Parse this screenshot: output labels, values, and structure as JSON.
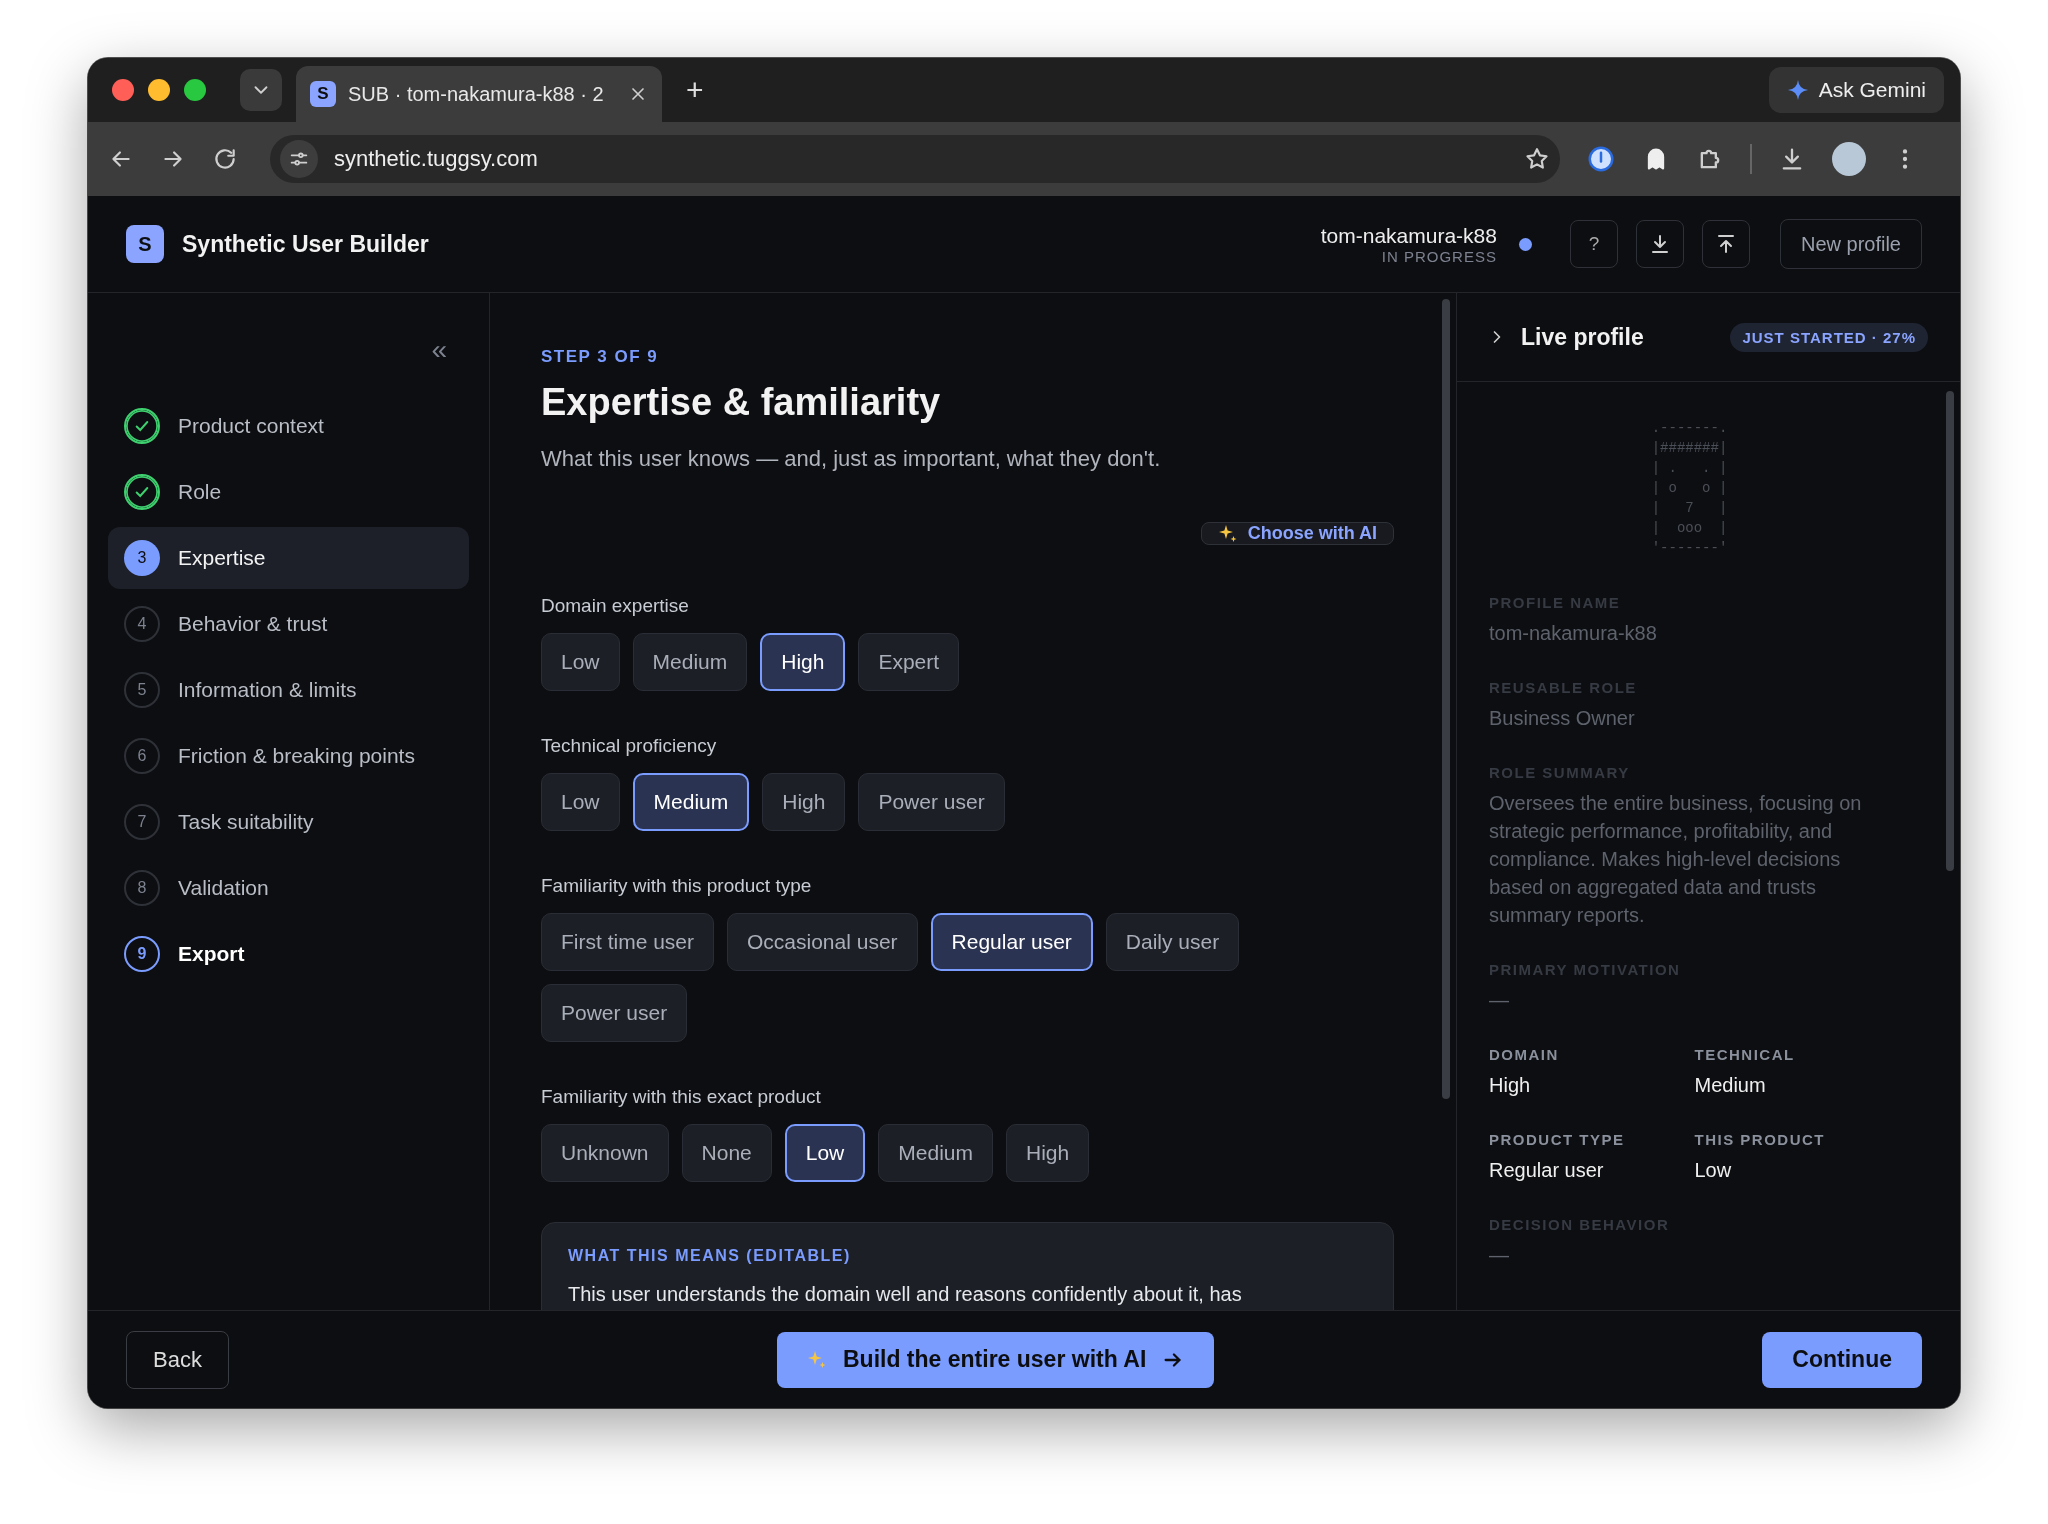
{
  "browser": {
    "tab": {
      "favicon": "S",
      "title": "SUB · tom-nakamura-k88 · 2"
    },
    "new_tab": "+",
    "ask_gemini": "Ask Gemini",
    "url": "synthetic.tuggsy.com"
  },
  "app": {
    "logo": "S",
    "title": "Synthetic User Builder",
    "profile_name": "tom-nakamura-k88",
    "status": "IN PROGRESS",
    "help": "?",
    "new_profile": "New profile"
  },
  "sidebar": {
    "collapse": "«",
    "steps": [
      {
        "label": "Product context",
        "kind": "done",
        "selected": false
      },
      {
        "label": "Role",
        "kind": "done",
        "selected": false
      },
      {
        "number": "3",
        "label": "Expertise",
        "kind": "current",
        "selected": true
      },
      {
        "number": "4",
        "label": "Behavior & trust",
        "kind": "pending",
        "selected": false
      },
      {
        "number": "5",
        "label": "Information & limits",
        "kind": "pending",
        "selected": false
      },
      {
        "number": "6",
        "label": "Friction & breaking points",
        "kind": "pending",
        "selected": false
      },
      {
        "number": "7",
        "label": "Task suitability",
        "kind": "pending",
        "selected": false
      },
      {
        "number": "8",
        "label": "Validation",
        "kind": "pending",
        "selected": false
      },
      {
        "number": "9",
        "label": "Export",
        "kind": "target",
        "selected": false
      }
    ]
  },
  "main": {
    "step": "STEP 3 OF 9",
    "title": "Expertise & familiarity",
    "subtitle": "What this user knows — and, just as important, what they don't.",
    "ai_button": "Choose with AI",
    "groups": [
      {
        "label": "Domain expertise",
        "options": [
          {
            "label": "Low",
            "selected": false
          },
          {
            "label": "Medium",
            "selected": false
          },
          {
            "label": "High",
            "selected": true
          },
          {
            "label": "Expert",
            "selected": false
          }
        ]
      },
      {
        "label": "Technical proficiency",
        "options": [
          {
            "label": "Low",
            "selected": false
          },
          {
            "label": "Medium",
            "selected": true
          },
          {
            "label": "High",
            "selected": false
          },
          {
            "label": "Power user",
            "selected": false
          }
        ]
      },
      {
        "label": "Familiarity with this product type",
        "options": [
          {
            "label": "First time user",
            "selected": false
          },
          {
            "label": "Occasional user",
            "selected": false
          },
          {
            "label": "Regular user",
            "selected": true
          },
          {
            "label": "Daily user",
            "selected": false
          },
          {
            "label": "Power user",
            "selected": false
          }
        ]
      },
      {
        "label": "Familiarity with this exact product",
        "options": [
          {
            "label": "Unknown",
            "selected": false
          },
          {
            "label": "None",
            "selected": false
          },
          {
            "label": "Low",
            "selected": true
          },
          {
            "label": "Medium",
            "selected": false
          },
          {
            "label": "High",
            "selected": false
          }
        ]
      }
    ],
    "note": {
      "title": "WHAT THIS MEANS (EDITABLE)",
      "text": "This user understands the domain well and reasons confidently about it, has"
    }
  },
  "profile": {
    "title": "Live profile",
    "badge": "JUST STARTED · 27%",
    "avatar_lines": [
      ".-------.",
      "|#######|",
      "| .   . |",
      "| o   o |",
      "|   7   |",
      "|  ooo  |",
      "'-------'"
    ],
    "fields": [
      {
        "label": "PROFILE NAME",
        "value": "tom-nakamura-k88",
        "dimmed": true
      },
      {
        "label": "REUSABLE ROLE",
        "value": "Business Owner",
        "dimmed": true
      },
      {
        "label": "ROLE SUMMARY",
        "value": "Oversees the entire business, focusing on strategic performance, profitability, and compliance. Makes high-level decisions based on aggregated data and trusts summary reports.",
        "dimmed": true
      },
      {
        "label": "PRIMARY MOTIVATION",
        "value": "—",
        "dimmed": true
      }
    ],
    "grid": [
      {
        "label": "DOMAIN",
        "value": "High",
        "dimmed": false
      },
      {
        "label": "TECHNICAL",
        "value": "Medium",
        "dimmed": false
      },
      {
        "label": "PRODUCT TYPE",
        "value": "Regular user",
        "dimmed": false
      },
      {
        "label": "THIS PRODUCT",
        "value": "Low",
        "dimmed": false
      }
    ],
    "more_fields": [
      {
        "label": "DECISION BEHAVIOR",
        "value": "—",
        "dimmed": true
      }
    ]
  },
  "footer": {
    "back": "Back",
    "build": "Build the entire user with AI",
    "continue": "Continue"
  }
}
